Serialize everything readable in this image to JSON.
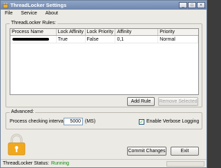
{
  "window": {
    "title": "ThreadLocker Settings",
    "controls": [
      "_",
      "□",
      "×"
    ]
  },
  "menu": [
    "File",
    "Service",
    "About"
  ],
  "rules_group": {
    "legend": "ThreadLocker Rules:",
    "columns": [
      "Process Name",
      "Lock Affinity",
      "Lock Priority",
      "Affinity",
      "Priority"
    ],
    "rows": [
      {
        "process_name": "",
        "lock_affinity": "True",
        "lock_priority": "False",
        "affinity": "0,1",
        "priority": "Normal"
      }
    ],
    "add_rule": "Add Rule",
    "remove_selected": "Remove Selected"
  },
  "advanced_group": {
    "legend": "Advanced:",
    "interval_label": "Process checking interval:",
    "interval_value": "5000",
    "interval_unit": "(MS)",
    "verbose_label": "Enable Verbose Logging",
    "verbose_checked": true
  },
  "actions": {
    "commit": "Commit Changes",
    "exit": "Exit"
  },
  "status": {
    "label": "ThreadLocker Status:",
    "value": "Running"
  },
  "colors": {
    "titlebar": "#7a91b8",
    "status_running": "#0a8a0a",
    "lock": "#f2a81d"
  },
  "icons": {
    "app": "app-icon",
    "lock": "padlock-icon"
  }
}
